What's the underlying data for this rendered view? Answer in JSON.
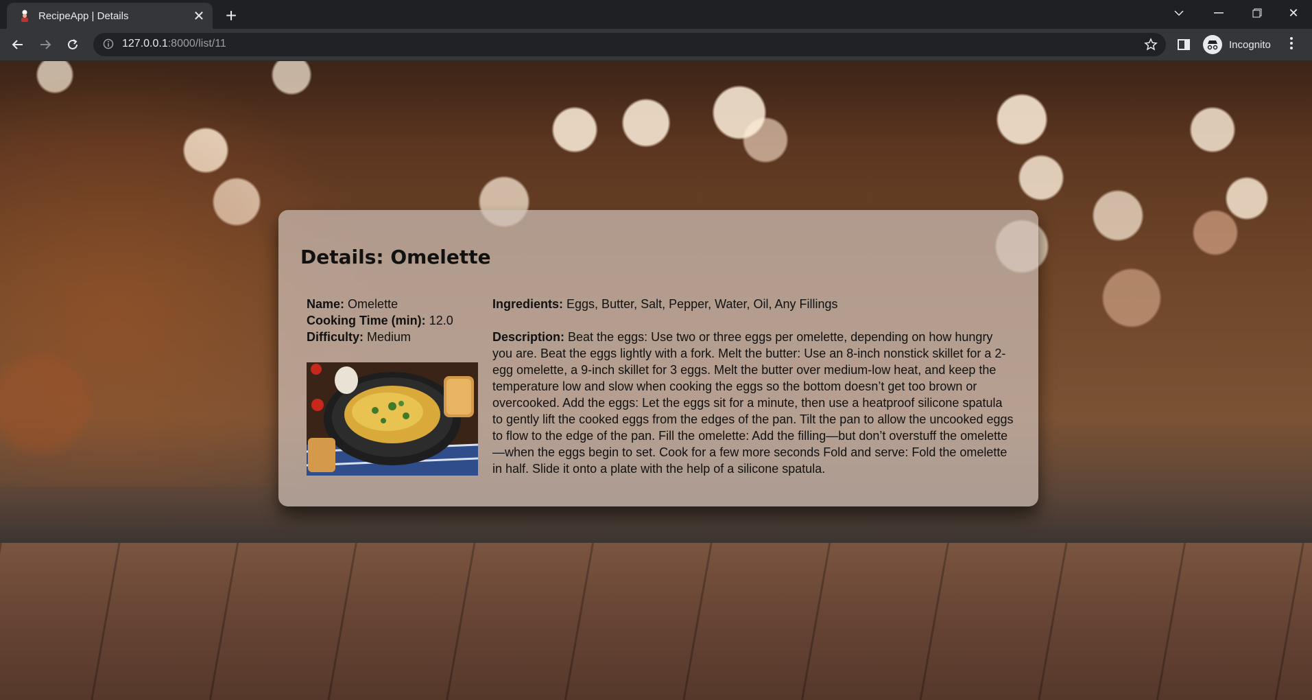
{
  "browser": {
    "tab_title": "RecipeApp | Details",
    "url_host": "127.0.0.1",
    "url_path": ":8000/list/11",
    "profile_label": "Incognito"
  },
  "recipe": {
    "heading": "Details: Omelette",
    "name_label": "Name:",
    "name": "Omelette",
    "time_label": "Cooking Time (min):",
    "time": "12.0",
    "difficulty_label": "Difficulty:",
    "difficulty": "Medium",
    "ingredients_label": "Ingredients:",
    "ingredients": "Eggs, Butter, Salt, Pepper, Water, Oil, Any Fillings",
    "description_label": "Description:",
    "description": "Beat the eggs: Use two or three eggs per omelette, depending on how hungry you are. Beat the eggs lightly with a fork. Melt the butter: Use an 8-inch nonstick skillet for a 2-egg omelette, a 9-inch skillet for 3 eggs. Melt the butter over medium-low heat, and keep the temperature low and slow when cooking the eggs so the bottom doesn’t get too brown or overcooked. Add the eggs: Let the eggs sit for a minute, then use a heatproof silicone spatula to gently lift the cooked eggs from the edges of the pan. Tilt the pan to allow the uncooked eggs to flow to the edge of the pan. Fill the omelette: Add the filling—but don’t overstuff the omelette—when the eggs begin to set. Cook for a few more seconds Fold and serve: Fold the omelette in half. Slide it onto a plate with the help of a silicone spatula."
  }
}
